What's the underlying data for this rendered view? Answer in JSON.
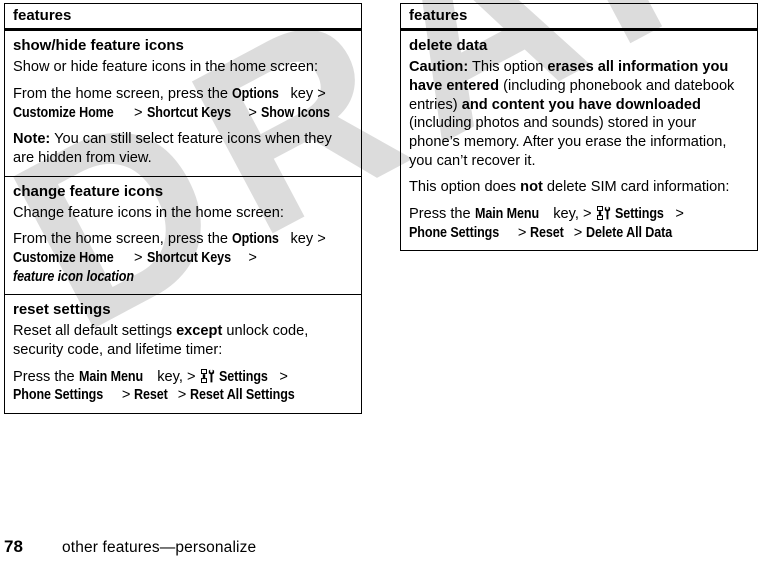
{
  "page": {
    "number": "78",
    "footer_title": "other features—personalize",
    "watermark": "DRAFT"
  },
  "left_table": {
    "header": "features",
    "rows": [
      {
        "title": "show/hide feature icons",
        "paragraphs": [
          {
            "segments": [
              {
                "text": "Show or hide feature icons in the home screen:",
                "style": "plain"
              }
            ]
          },
          {
            "segments": [
              {
                "text": "From the home screen, press the ",
                "style": "plain"
              },
              {
                "text": "Options",
                "style": "ui"
              },
              {
                "text": " key > ",
                "style": "plain"
              },
              {
                "text": "Customize Home",
                "style": "ui"
              },
              {
                "text": " > ",
                "style": "plain"
              },
              {
                "text": "Shortcut Keys",
                "style": "ui"
              },
              {
                "text": " > ",
                "style": "plain"
              },
              {
                "text": "Show Icons",
                "style": "ui"
              }
            ]
          },
          {
            "segments": [
              {
                "text": "Note:",
                "style": "bold"
              },
              {
                "text": " You can still select feature icons when they are hidden from view.",
                "style": "plain"
              }
            ]
          }
        ]
      },
      {
        "title": "change feature icons",
        "paragraphs": [
          {
            "segments": [
              {
                "text": "Change feature icons in the home screen:",
                "style": "plain"
              }
            ]
          },
          {
            "segments": [
              {
                "text": "From the home screen, press the ",
                "style": "plain"
              },
              {
                "text": "Options",
                "style": "ui"
              },
              {
                "text": " key > ",
                "style": "plain"
              },
              {
                "text": "Customize Home",
                "style": "ui"
              },
              {
                "text": " > ",
                "style": "plain"
              },
              {
                "text": "Shortcut Keys",
                "style": "ui"
              },
              {
                "text": " > ",
                "style": "plain"
              },
              {
                "text": "feature icon location",
                "style": "italic"
              }
            ]
          }
        ]
      },
      {
        "title": "reset settings",
        "paragraphs": [
          {
            "segments": [
              {
                "text": "Reset all default settings ",
                "style": "plain"
              },
              {
                "text": "except",
                "style": "bold"
              },
              {
                "text": " unlock code, security code, and lifetime timer:",
                "style": "plain"
              }
            ]
          },
          {
            "segments": [
              {
                "text": "Press the ",
                "style": "plain"
              },
              {
                "text": "Main Menu",
                "style": "ui"
              },
              {
                "text": " key, > ",
                "style": "plain"
              },
              {
                "text": "",
                "style": "settings-glyph"
              },
              {
                "text": "Settings",
                "style": "ui"
              },
              {
                "text": " > ",
                "style": "plain"
              },
              {
                "text": "Phone Settings",
                "style": "ui"
              },
              {
                "text": " > ",
                "style": "plain"
              },
              {
                "text": "Reset",
                "style": "ui"
              },
              {
                "text": " > ",
                "style": "plain"
              },
              {
                "text": "Reset All Settings",
                "style": "ui"
              }
            ]
          }
        ]
      }
    ]
  },
  "right_table": {
    "header": "features",
    "rows": [
      {
        "title": "delete data",
        "paragraphs": [
          {
            "segments": [
              {
                "text": "Caution:",
                "style": "bold"
              },
              {
                "text": " This option ",
                "style": "plain"
              },
              {
                "text": "erases all information you have entered",
                "style": "bold"
              },
              {
                "text": " (including phonebook and datebook entries) ",
                "style": "plain"
              },
              {
                "text": "and content you have downloaded",
                "style": "bold"
              },
              {
                "text": " (including photos and sounds) stored in your phone’s memory. After you erase the information, you can’t recover it.",
                "style": "plain"
              }
            ]
          },
          {
            "segments": [
              {
                "text": "This option does ",
                "style": "plain"
              },
              {
                "text": "not",
                "style": "bold"
              },
              {
                "text": " delete SIM card information:",
                "style": "plain"
              }
            ]
          },
          {
            "segments": [
              {
                "text": "Press the ",
                "style": "plain"
              },
              {
                "text": "Main Menu",
                "style": "ui"
              },
              {
                "text": " key, > ",
                "style": "plain"
              },
              {
                "text": "",
                "style": "settings-glyph"
              },
              {
                "text": "Settings",
                "style": "ui"
              },
              {
                "text": " > ",
                "style": "plain"
              },
              {
                "text": "Phone Settings",
                "style": "ui"
              },
              {
                "text": " > ",
                "style": "plain"
              },
              {
                "text": "Reset",
                "style": "ui"
              },
              {
                "text": " > ",
                "style": "plain"
              },
              {
                "text": "Delete All Data",
                "style": "ui"
              }
            ]
          }
        ]
      }
    ]
  },
  "icons": {
    "settings_glyph": "settings-tools-icon"
  },
  "colors": {
    "text": "#000000",
    "rule": "#000000",
    "watermark": "#dcdcdc",
    "background": "#ffffff"
  }
}
